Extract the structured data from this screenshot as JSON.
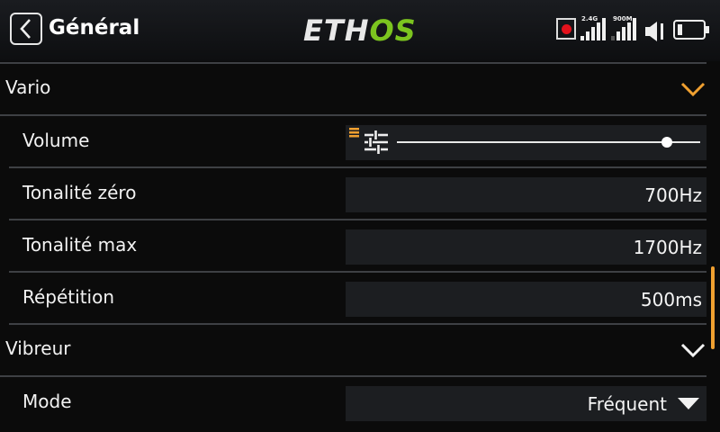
{
  "header": {
    "title": "Général",
    "logo_part1": "ETH",
    "logo_part2": "OS",
    "rx1_label": "2.4G",
    "rx2_label": "900M"
  },
  "colors": {
    "accent": "#f0a030",
    "logo_green": "#7cc41f",
    "record": "#e3121c"
  },
  "sections": {
    "vario": {
      "label": "Vario",
      "volume": {
        "label": "Volume",
        "level": 0.89
      },
      "tone_zero": {
        "label": "Tonalité zéro",
        "value": "700Hz"
      },
      "tone_max": {
        "label": "Tonalité max",
        "value": "1700Hz"
      },
      "repeat": {
        "label": "Répétition",
        "value": "500ms"
      }
    },
    "vibreur": {
      "label": "Vibreur",
      "mode": {
        "label": "Mode",
        "value": "Fréquent"
      }
    }
  }
}
